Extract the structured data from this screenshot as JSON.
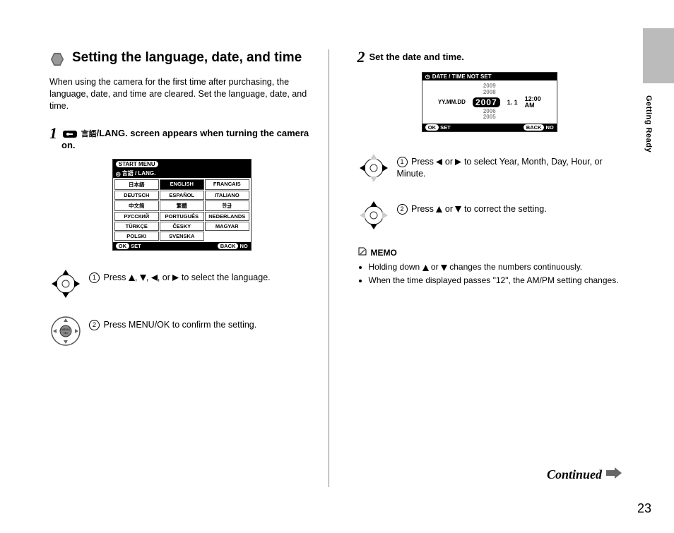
{
  "page_number": "23",
  "side_label": "Getting Ready",
  "heading": "Setting the language, date, and time",
  "intro": "When using the camera for the first time after purchasing, the language, date, and time are cleared. Set the language, date, and time.",
  "step1": {
    "num": "1",
    "label_suffix": "/LANG.",
    "text_rest": " screen appears when turning the camera on.",
    "lcd": {
      "start_menu": "START MENU",
      "subtitle": "言語 / LANG.",
      "languages": [
        "日本語",
        "ENGLISH",
        "FRANCAIS",
        "DEUTSCH",
        "ESPAÑOL",
        "ITALIANO",
        "中文简",
        "繁體",
        "한글",
        "РУССКИЙ",
        "PORTUGUÊS",
        "NEDERLANDS",
        "TÜRKÇE",
        "ČESKY",
        "MAGYAR",
        "POLSKI",
        "SVENSKA",
        ""
      ],
      "selected_index": 1,
      "ok_label": "OK",
      "set_label": "SET",
      "back_label": "BACK",
      "no_label": "NO"
    },
    "sub1": "Press ▲, ▼, ◀, or ▶ to select the language.",
    "sub2": "Press MENU/OK to confirm the setting."
  },
  "step2": {
    "num": "2",
    "text": "Set the date and time.",
    "lcd": {
      "title": "DATE / TIME NOT SET",
      "years_above": [
        "2009",
        "2008"
      ],
      "year_selected": "2007",
      "years_below": [
        "2006",
        "2005"
      ],
      "format": "YY.MM.DD",
      "date_rest": "1.  1",
      "time": "12:00",
      "ampm": "AM",
      "ok_label": "OK",
      "set_label": "SET",
      "back_label": "BACK",
      "no_label": "NO"
    },
    "sub1": "Press ◀ or ▶ to select Year, Month, Day, Hour, or Minute.",
    "sub2": "Press ▲ or ▼ to correct the setting."
  },
  "memo": {
    "title": "MEMO",
    "items": [
      "Holding down ▲ or ▼ changes the numbers continuously.",
      "When the time displayed passes \"12\", the AM/PM setting changes."
    ]
  },
  "continued": "Continued"
}
